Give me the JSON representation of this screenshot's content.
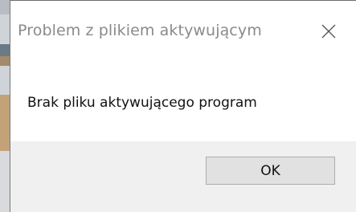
{
  "dialog": {
    "title": "Problem z plikiem aktywującym",
    "message": "Brak pliku aktywującego program",
    "ok_label": "OK",
    "close_icon": "close-icon"
  },
  "colors": {
    "title_text": "#8a8a8a",
    "message_text": "#111111",
    "footer_bg": "#f0f0f0",
    "button_bg": "#e1e1e1",
    "button_border": "#adadad"
  }
}
